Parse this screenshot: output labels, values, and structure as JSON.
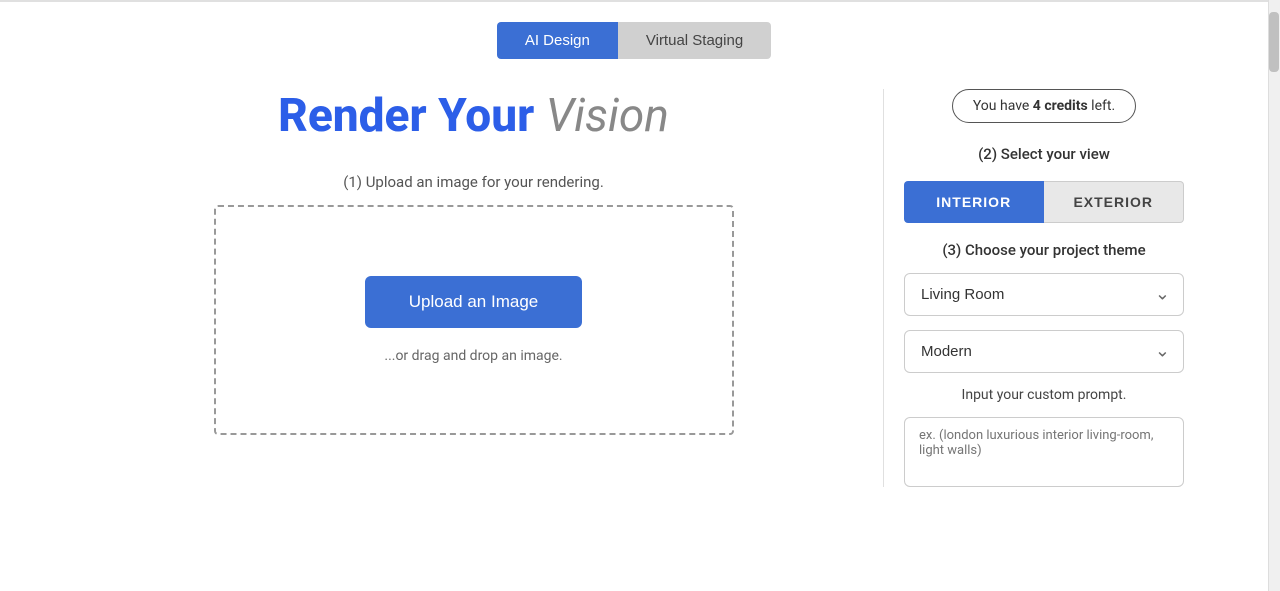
{
  "tabs": {
    "ai_design_label": "AI Design",
    "virtual_staging_label": "Virtual Staging"
  },
  "left_panel": {
    "title_main": "Render Your ",
    "title_italic": "Vision",
    "upload_instruction": "(1) Upload an image for your rendering.",
    "upload_button_label": "Upload an Image",
    "drag_drop_text": "...or drag and drop an image."
  },
  "right_panel": {
    "credits_text_prefix": "You have ",
    "credits_count": "4",
    "credits_text_bold": "credits",
    "credits_text_suffix": " left.",
    "select_view_label": "(2) Select your view",
    "view_interior_label": "INTERIOR",
    "view_exterior_label": "EXTERIOR",
    "choose_theme_label": "(3) Choose your project theme",
    "room_type_value": "Living Room",
    "style_value": "Modern",
    "custom_prompt_label": "Input your custom prompt.",
    "custom_prompt_placeholder": "ex. (london luxurious interior living-room, light walls)"
  }
}
